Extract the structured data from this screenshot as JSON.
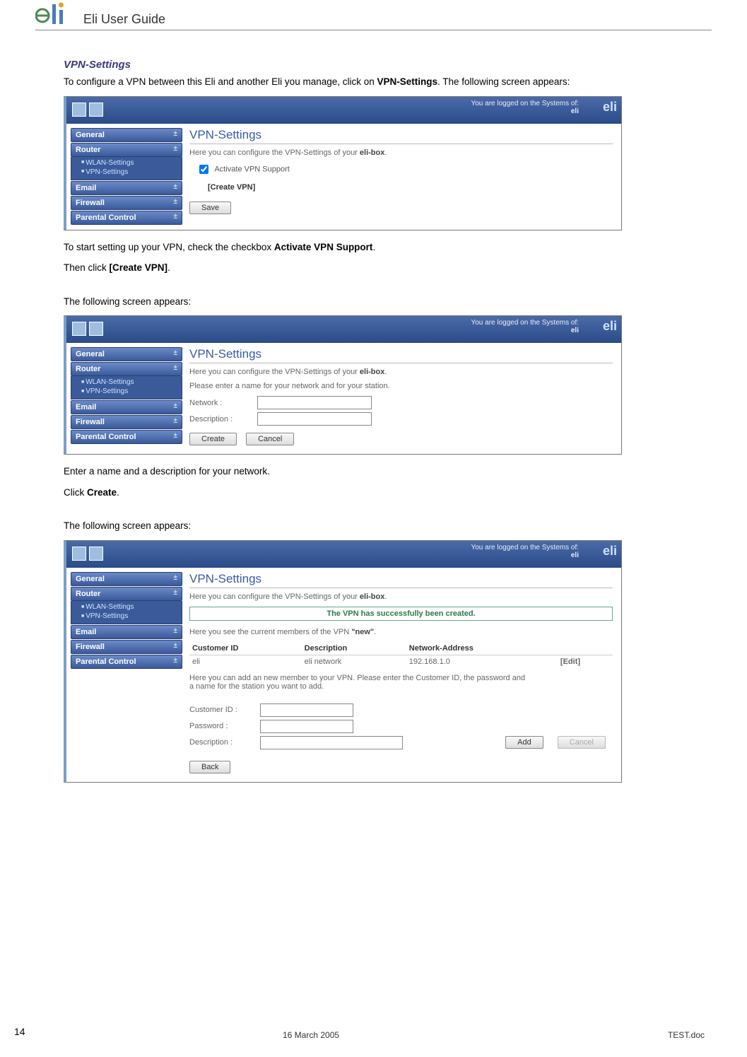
{
  "header": {
    "title": "Eli User Guide"
  },
  "section": {
    "heading": "VPN-Settings",
    "intro_a": "To configure a VPN between this Eli and another Eli you manage, click on ",
    "intro_bold": "VPN-Settings",
    "intro_b": ". The following screen appears:",
    "after1_a": "To start setting up your VPN, check the checkbox ",
    "after1_bold": "Activate VPN Support",
    "after1_b": ".",
    "after1c_a": "Then click ",
    "after1c_bold": "[Create VPN]",
    "after1c_b": ".",
    "lead2": "The following screen appears:",
    "after2": "Enter a name and a description for your network.",
    "after2b_a": "Click ",
    "after2b_bold": "Create",
    "after2b_b": ".",
    "lead3": "The following screen appears:"
  },
  "ui": {
    "topbar_text": "You are logged on the Systems of:",
    "topbar_sub": "eli",
    "brand": "eli",
    "sidebar": {
      "general": "General",
      "router": "Router",
      "sub1": "WLAN-Settings",
      "sub2": "VPN-Settings",
      "email": "Email",
      "firewall": "Firewall",
      "parental": "Parental Control"
    },
    "panel_title": "VPN-Settings",
    "intro_line_a": "Here you can configure the VPN-Settings of your ",
    "intro_line_bold": "eli-box",
    "intro_line_b": ".",
    "activate_label": "Activate VPN Support",
    "create_vpn_link": "[Create VPN]",
    "save_btn": "Save",
    "prompt_line": "Please enter a name for your network and for your station.",
    "network_label": "Network :",
    "description_label": "Description :",
    "create_btn": "Create",
    "cancel_btn": "Cancel",
    "success_msg": "The VPN has successfully been created.",
    "members_line_a": "Here you see the current members of the VPN ",
    "members_line_bold": "\"new\"",
    "members_line_b": ".",
    "th_customer": "Customer ID",
    "th_description": "Description",
    "th_network": "Network-Address",
    "row_customer": "eli",
    "row_description": "eli network",
    "row_network": "192.168.1.0",
    "edit_link": "[Edit]",
    "add_member_line": "Here you can add an new member to your VPN. Please enter the Customer ID, the password and a name for the station you want to add.",
    "customer_id_label": "Customer ID :",
    "password_label": "Password :",
    "desc_label": "Description :",
    "add_btn": "Add",
    "back_btn": "Back"
  },
  "footer": {
    "page": "14",
    "date": "16 March 2005",
    "file": "TEST.doc"
  }
}
